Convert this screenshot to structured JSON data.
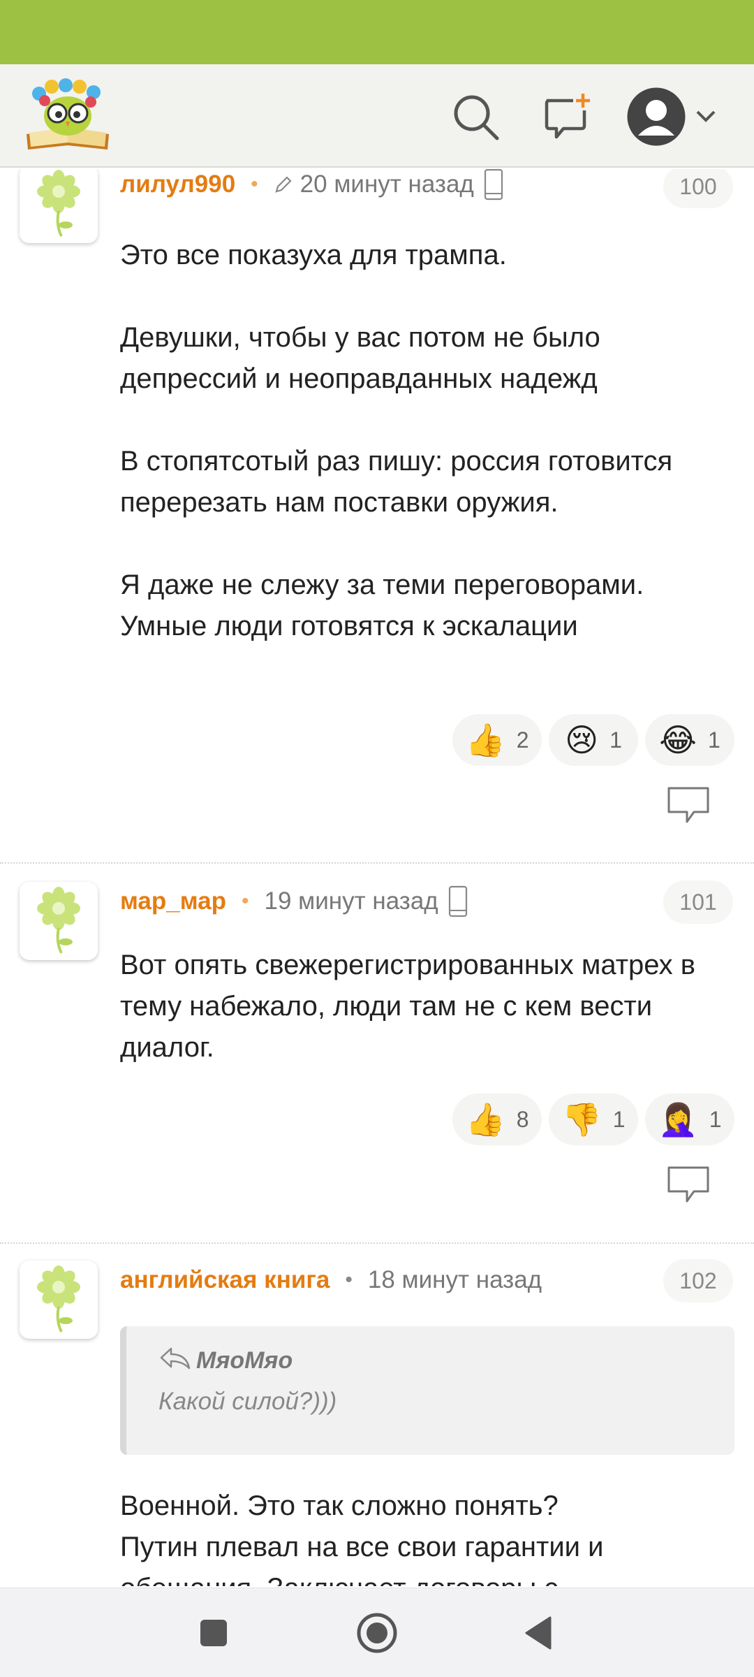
{
  "header": {
    "logo_icon": "owl-book-logo",
    "search_icon": "search-icon",
    "new_post_icon": "new-comment-icon",
    "profile_icon": "user-avatar-icon"
  },
  "comments": [
    {
      "author": "лилул990",
      "time": "20 минут назад",
      "edited": true,
      "device": "mobile",
      "number": "100",
      "text": "Это все показуха для трампа.\n\nДевушки, чтобы у вас потом не было депрессий и неоправданных надежд\n\nВ стопятсотый раз пишу: россия готовится перерезать нам поставки оружия.\n\nЯ даже не слежу за теми переговорами. Умные люди готовятся к эскалации",
      "reactions": [
        {
          "emoji": "👍",
          "count": "2"
        },
        {
          "emoji": "😢",
          "count": "1"
        },
        {
          "emoji": "😂",
          "count": "1"
        }
      ]
    },
    {
      "author": "мар_мар",
      "time": "19 минут назад",
      "device": "mobile",
      "number": "101",
      "text": "Вот опять свежерегистрированных матрех в тему набежало, люди там не с кем вести диалог.",
      "reactions": [
        {
          "emoji": "👍",
          "count": "8"
        },
        {
          "emoji": "👎",
          "count": "1"
        },
        {
          "emoji": "🤦‍♀️",
          "count": "1"
        }
      ]
    },
    {
      "author": "английская книга",
      "time": "18 минут назад",
      "number": "102",
      "quote_author": "МяоМяо",
      "quote_text": "Какой силой?)))",
      "text": "Военной. Это так сложно понять?\nПутин плевал на все свои гарантии и обещания. Заключает договоры с"
    }
  ],
  "colors": {
    "status_bar": "#9dc143",
    "author": "#e47c12",
    "header_bg": "#f2f2ee"
  },
  "nav": {
    "recents_icon": "square-icon",
    "home_icon": "circle-home-icon",
    "back_icon": "triangle-back-icon"
  }
}
